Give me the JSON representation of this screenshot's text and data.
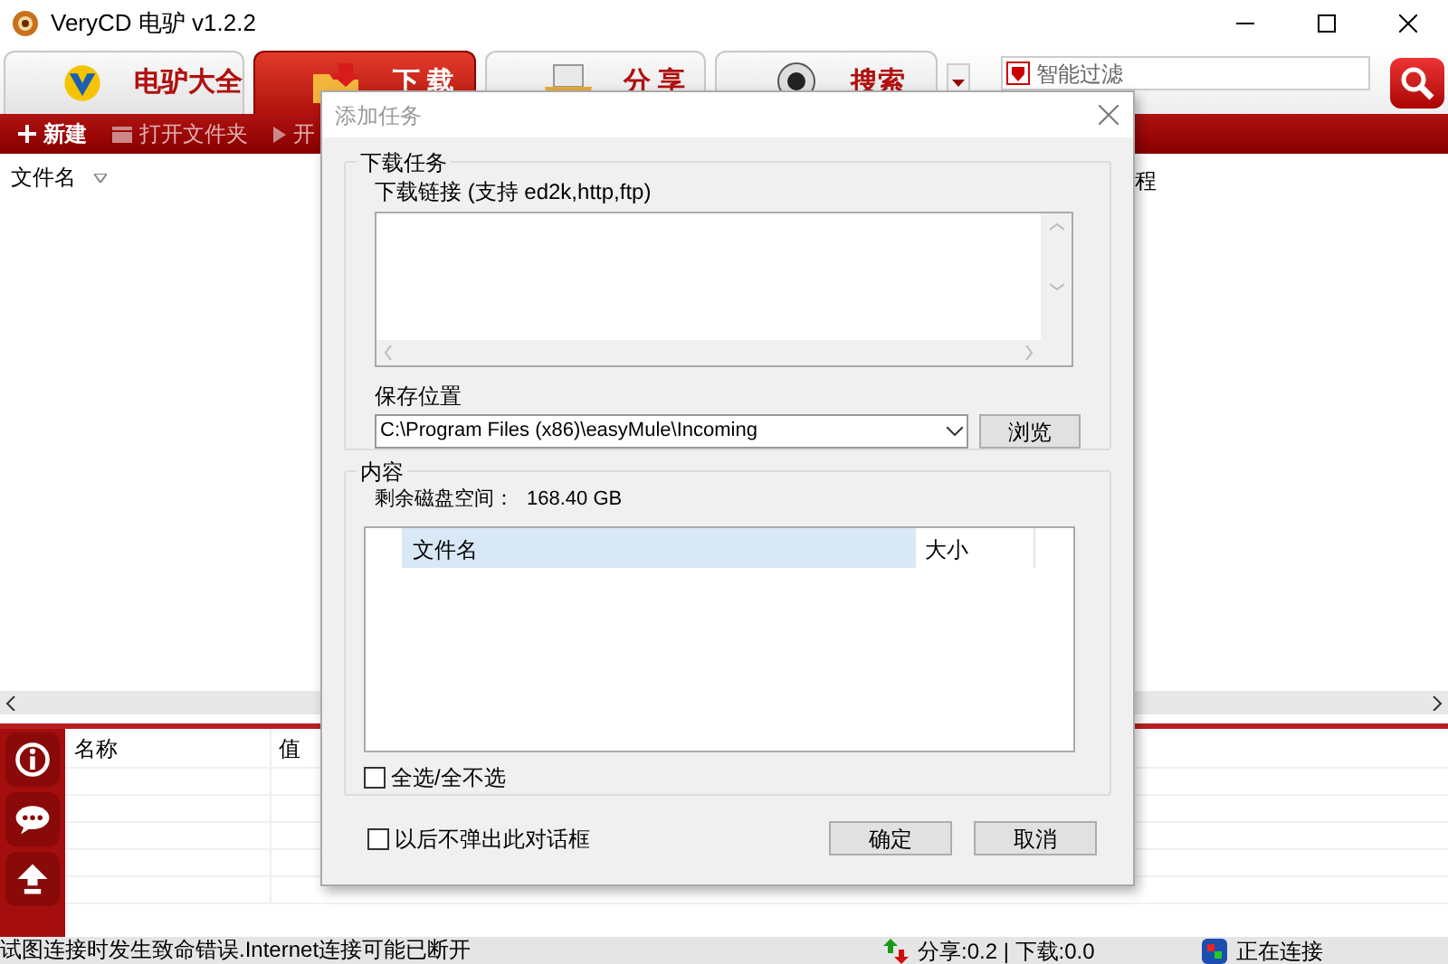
{
  "window": {
    "title": "VeryCD 电驴 v1.2.2"
  },
  "tabs": [
    {
      "label": "电驴大全",
      "selected": false
    },
    {
      "label": "下 载",
      "selected": true
    },
    {
      "label": "分 享",
      "selected": false
    },
    {
      "label": "搜索",
      "selected": false
    }
  ],
  "filter": {
    "placeholder": "智能过滤"
  },
  "toolbar": [
    {
      "label": "新建"
    },
    {
      "label": "打开文件夹"
    },
    {
      "label": "开"
    }
  ],
  "list": {
    "columns": [
      "文件名",
      "程"
    ]
  },
  "details": {
    "columns": [
      "名称",
      "值"
    ]
  },
  "status_bar": {
    "message": "试图连接时发生致命错误.Internet连接可能已断开",
    "traffic": "分享:0.2 | 下载:0.0",
    "connection": "正在连接"
  },
  "dialog": {
    "title": "添加任务",
    "task_group": {
      "title": "下载任务",
      "link_label": "下载链接 (支持 ed2k,http,ftp)",
      "save_label": "保存位置",
      "save_path": "C:\\Program Files (x86)\\easyMule\\Incoming",
      "browse": "浏览"
    },
    "content_group": {
      "title": "内容",
      "space_label": "剩余磁盘空间：",
      "space_value": "168.40 GB",
      "columns": [
        "文件名",
        "大小"
      ],
      "select_all": {
        "label": "全选/全不选",
        "checked": false
      }
    },
    "no_popup": {
      "label": "以后不弹出此对话框",
      "checked": false
    },
    "buttons": [
      "确定",
      "取消"
    ]
  }
}
